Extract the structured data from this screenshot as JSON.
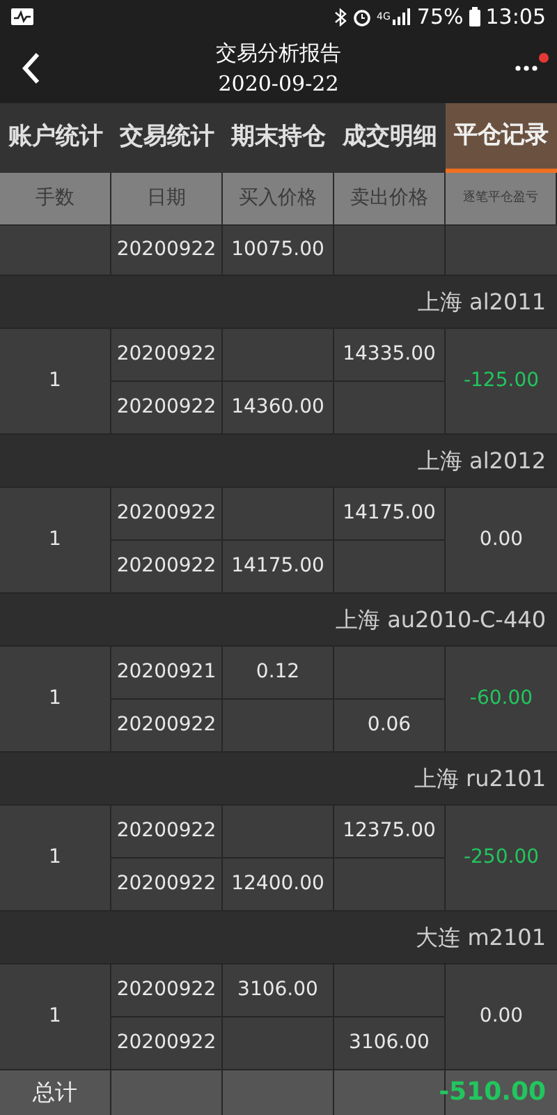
{
  "status_bar": {
    "battery": "75%",
    "time": "13:05",
    "network": "4G"
  },
  "header": {
    "title": "交易分析报告",
    "date": "2020-09-22"
  },
  "tabs": [
    {
      "label": "账户统计",
      "selected": false
    },
    {
      "label": "交易统计",
      "selected": false
    },
    {
      "label": "期末持仓",
      "selected": false
    },
    {
      "label": "成交明细",
      "selected": false
    },
    {
      "label": "平仓记录",
      "selected": true
    }
  ],
  "table": {
    "columns": [
      "手数",
      "日期",
      "买入价格",
      "卖出价格",
      "逐笔平仓盈亏"
    ],
    "partial_leg": {
      "date": "20200922",
      "buy": "10075.00"
    },
    "groups": [
      {
        "title": "上海 al2011",
        "lots": "1",
        "pnl": "-125.00",
        "color": "#22c55e",
        "legs": [
          {
            "date": "20200922",
            "sell": "14335.00"
          },
          {
            "date": "20200922",
            "buy": "14360.00"
          }
        ]
      },
      {
        "title": "上海 al2012",
        "lots": "1",
        "pnl": "0.00",
        "color": "#e5e5e5",
        "legs": [
          {
            "date": "20200922",
            "sell": "14175.00"
          },
          {
            "date": "20200922",
            "buy": "14175.00"
          }
        ]
      },
      {
        "title": "上海 au2010-C-440",
        "lots": "1",
        "pnl": "-60.00",
        "color": "#22c55e",
        "legs": [
          {
            "date": "20200921",
            "buy": "0.12"
          },
          {
            "date": "20200922",
            "sell": "0.06"
          }
        ]
      },
      {
        "title": "上海 ru2101",
        "lots": "1",
        "pnl": "-250.00",
        "color": "#22c55e",
        "legs": [
          {
            "date": "20200922",
            "sell": "12375.00"
          },
          {
            "date": "20200922",
            "buy": "12400.00"
          }
        ]
      },
      {
        "title": "大连 m2101",
        "lots": "1",
        "pnl": "0.00",
        "color": "#e5e5e5",
        "legs": [
          {
            "date": "20200922",
            "buy": "3106.00"
          },
          {
            "date": "20200922",
            "sell": "3106.00"
          }
        ]
      }
    ],
    "total": {
      "label": "总计",
      "pnl": "-510.00",
      "color": "#22c55e"
    }
  }
}
